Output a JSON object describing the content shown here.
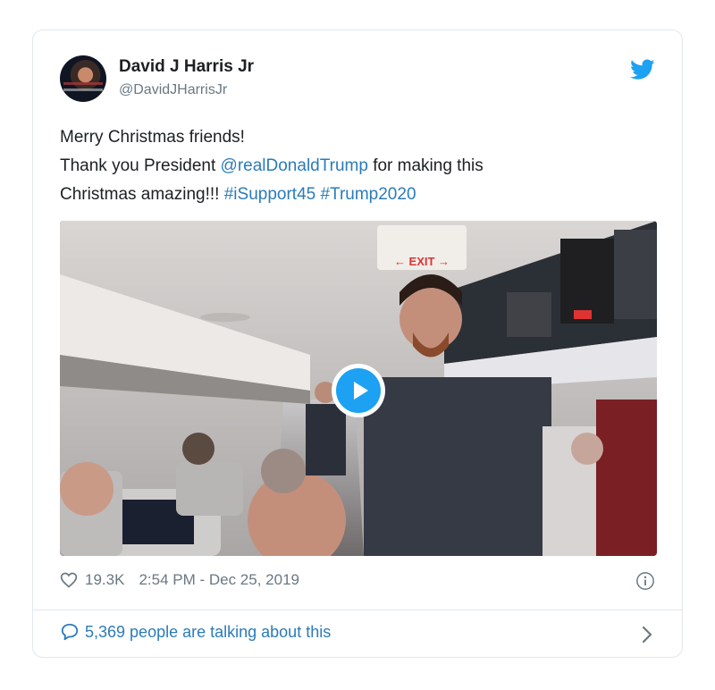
{
  "tweet": {
    "author": {
      "display_name": "David J Harris Jr",
      "handle": "@DavidJHarrisJr"
    },
    "text": {
      "line1": "Merry Christmas friends!",
      "line2_prefix": "Thank you President ",
      "line2_mention": "@realDonaldTrump",
      "line2_suffix": " for making this",
      "line3_prefix": "Christmas amazing!!! ",
      "line3_hashtag1": "#iSupport45",
      "line3_space": " ",
      "line3_hashtag2": "#Trump2020"
    },
    "media": {
      "type": "video",
      "exit_sign": "← EXIT →"
    },
    "likes": "19.3K",
    "timestamp": "2:54 PM - Dec 25, 2019",
    "talking": "5,369 people are talking about this"
  },
  "icons": {
    "brand": "twitter-bird-icon",
    "like": "heart-icon",
    "info": "info-icon",
    "conversation": "speech-bubble-icon",
    "chevron": "chevron-right-icon",
    "play": "play-icon"
  },
  "colors": {
    "link": "#2b7bb9",
    "brand_blue": "#1da1f2",
    "muted": "#697882",
    "text": "#1c2022",
    "border": "#e1e8ed"
  }
}
